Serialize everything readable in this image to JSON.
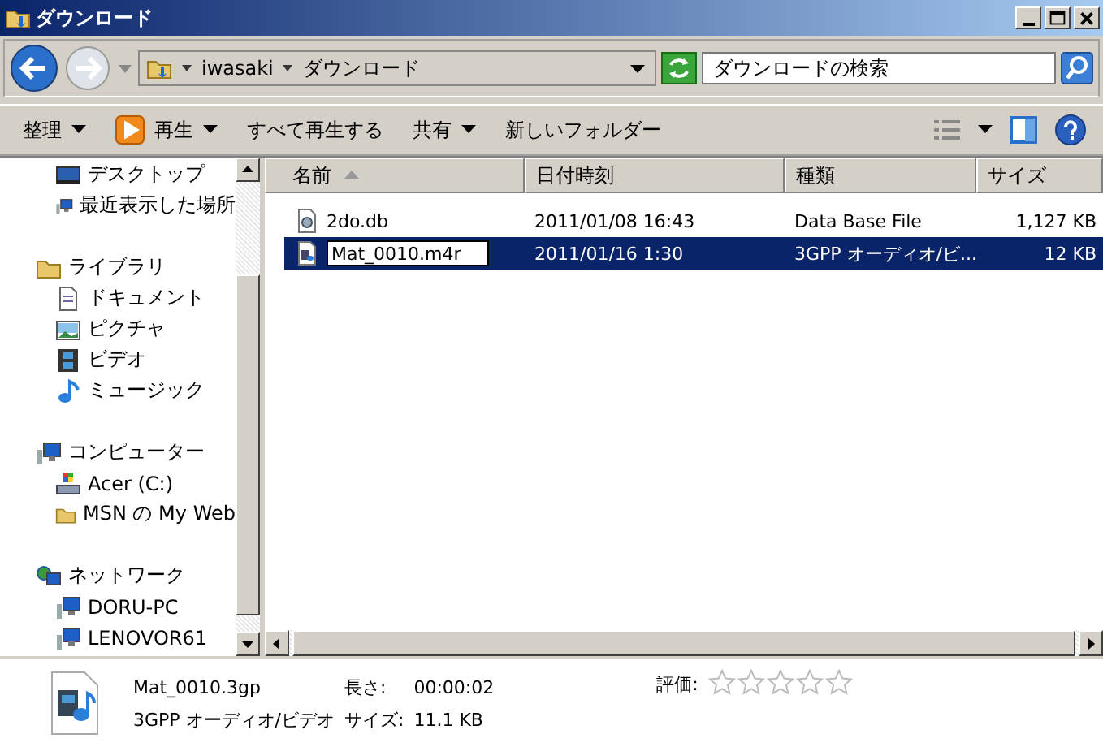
{
  "window": {
    "title": "ダウンロード"
  },
  "address": {
    "segments": [
      "iwasaki",
      "ダウンロード"
    ]
  },
  "search": {
    "placeholder": "ダウンロードの検索"
  },
  "toolbar": [
    {
      "label": "整理",
      "kind": "menu"
    },
    {
      "label": "再生",
      "kind": "play"
    },
    {
      "label": "すべて再生する",
      "kind": "plain"
    },
    {
      "label": "共有",
      "kind": "menu"
    },
    {
      "label": "新しいフォルダー",
      "kind": "plain"
    }
  ],
  "sidebar": {
    "groups": [
      {
        "items": [
          {
            "label": "デスクトップ",
            "kind": "desktop"
          },
          {
            "label": "最近表示した場所",
            "kind": "computer"
          }
        ]
      },
      {
        "items": [
          {
            "label": "ライブラリ",
            "kind": "folder"
          },
          {
            "label": "ドキュメント",
            "kind": "doc"
          },
          {
            "label": "ピクチャ",
            "kind": "picture"
          },
          {
            "label": "ビデオ",
            "kind": "film"
          },
          {
            "label": "ミュージック",
            "kind": "music"
          }
        ]
      },
      {
        "items": [
          {
            "label": "コンピューター",
            "kind": "computer"
          },
          {
            "label": "Acer (C:)",
            "kind": "drive"
          },
          {
            "label": "MSN の My Web",
            "kind": "folder"
          }
        ]
      },
      {
        "items": [
          {
            "label": "ネットワーク",
            "kind": "network"
          },
          {
            "label": "DORU-PC",
            "kind": "computer"
          },
          {
            "label": "LENOVOR61",
            "kind": "computer"
          }
        ]
      }
    ]
  },
  "table": {
    "columns": [
      {
        "label": "名前",
        "sorted": true
      },
      {
        "label": "日付時刻",
        "sorted": false
      },
      {
        "label": "種類",
        "sorted": false
      },
      {
        "label": "サイズ",
        "sorted": false
      }
    ],
    "rows": [
      {
        "name": "2do.db",
        "date": "2011/01/08 16:43",
        "type": "Data Base File",
        "size": "1,127 KB",
        "selected": false,
        "renaming": false,
        "kind": "db"
      },
      {
        "name": "Mat_0010.m4r",
        "date": "2011/01/16 1:30",
        "type": "3GPP オーディオ/ビ...",
        "size": "12 KB",
        "selected": true,
        "renaming": true,
        "kind": "media"
      }
    ]
  },
  "details": {
    "name": "Mat_0010.3gp",
    "type": "3GPP オーディオ/ビデオ",
    "length_label": "長さ:",
    "length": "00:00:02",
    "size_label": "サイズ:",
    "size": "11.1 KB",
    "rating_label": "評価:",
    "stars": 0
  }
}
